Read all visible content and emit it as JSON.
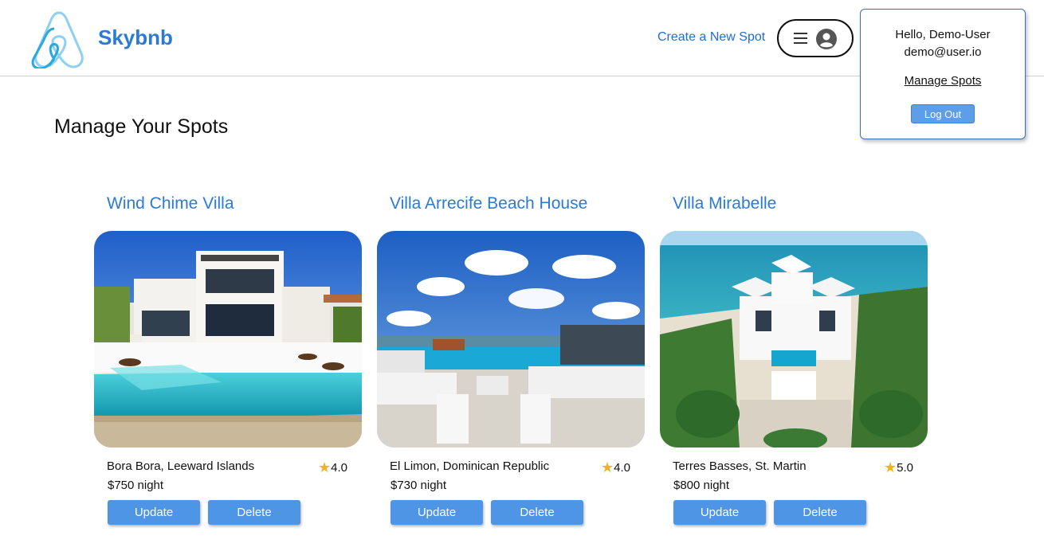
{
  "header": {
    "brand": "Skybnb",
    "create_link": "Create a New Spot"
  },
  "user_menu": {
    "greeting": "Hello, Demo-User",
    "email": "demo@user.io",
    "manage_link": "Manage Spots",
    "logout_label": "Log Out"
  },
  "page": {
    "title": "Manage Your Spots"
  },
  "spots": [
    {
      "name": "Wind Chime Villa",
      "location": "Bora Bora, Leeward Islands",
      "rating": "4.0",
      "price": "$750 night",
      "update_label": "Update",
      "delete_label": "Delete"
    },
    {
      "name": "Villa Arrecife Beach House",
      "location": "El Limon, Dominican Republic",
      "rating": "4.0",
      "price": "$730 night",
      "update_label": "Update",
      "delete_label": "Delete"
    },
    {
      "name": "Villa Mirabelle",
      "location": "Terres Basses, St. Martin",
      "rating": "5.0",
      "price": "$800 night",
      "update_label": "Update",
      "delete_label": "Delete"
    }
  ],
  "icons": {
    "logo": "airbnb-style-logo-icon",
    "menu": "hamburger-icon",
    "user": "user-circle-icon",
    "rating": "star-icon"
  },
  "colors": {
    "brand": "#2a7ad6",
    "button": "#4e95e6",
    "star": "#f3b319"
  }
}
